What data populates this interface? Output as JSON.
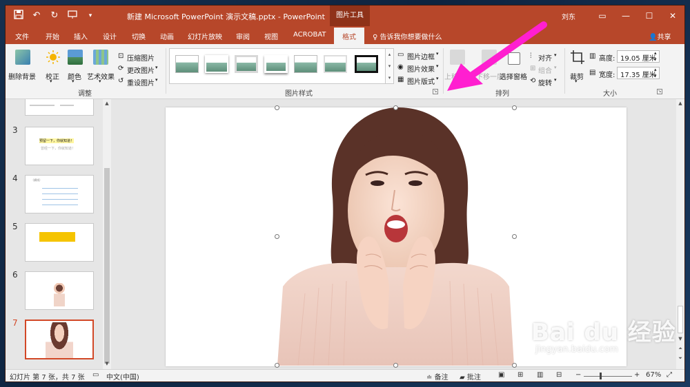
{
  "window": {
    "document_title": "新建 Microsoft PowerPoint 演示文稿.pptx  -  PowerPoint",
    "context_tools": "图片工具",
    "user": "刘东",
    "controls": {
      "ribbon_options": "▭",
      "minimize": "—",
      "maximize": "☐",
      "close": "✕"
    }
  },
  "tabs": [
    "文件",
    "开始",
    "插入",
    "设计",
    "切换",
    "动画",
    "幻灯片放映",
    "审阅",
    "视图",
    "ACROBAT"
  ],
  "active_tab": "格式",
  "tell_me": "告诉我你想要做什么",
  "share": "共享",
  "ribbon": {
    "adjust": {
      "remove_background": "删除背景",
      "corrections": "校正",
      "color": "颜色",
      "artistic": "艺术效果",
      "compress": "压缩图片",
      "change": "更改图片",
      "reset": "重设图片",
      "label": "调整"
    },
    "styles": {
      "border": "图片边框",
      "effects": "图片效果",
      "layout": "图片版式",
      "label": "图片样式"
    },
    "arrange": {
      "bring_forward": "上移",
      "send_backward": "下移一层",
      "selection_pane": "选择窗格",
      "align": "对齐",
      "group": "组合",
      "rotate": "旋转",
      "label": "排列"
    },
    "size": {
      "crop": "裁剪",
      "height_label": "高度:",
      "height_value": "19.05 厘米",
      "width_label": "宽度:",
      "width_value": "17.35 厘米",
      "label": "大小"
    }
  },
  "slides": [
    {
      "num": "3",
      "line1": "预留一下，你就知道！",
      "line2": "曾经一下，你就知道！"
    },
    {
      "num": "4",
      "line1": "（横线）"
    },
    {
      "num": "5"
    },
    {
      "num": "6"
    },
    {
      "num": "7"
    }
  ],
  "status": {
    "slide_info": "幻灯片 第 7 张，共 7 张",
    "language": "中文(中国)",
    "notes": "备注",
    "comments": "批注",
    "zoom": "67%"
  },
  "watermark": {
    "logo": "Bai du 经验",
    "url": "jingyan.baidu.com"
  },
  "colors": {
    "accent": "#b7472a",
    "arrow": "#ff1fd0",
    "selected_thumb": "#d24726"
  },
  "icons": {
    "save": "save-icon",
    "undo": "undo-icon",
    "redo": "redo-icon",
    "present": "present-icon",
    "customize": "chevron-down-icon",
    "tellme": "lightbulb-icon",
    "share": "person-icon"
  }
}
